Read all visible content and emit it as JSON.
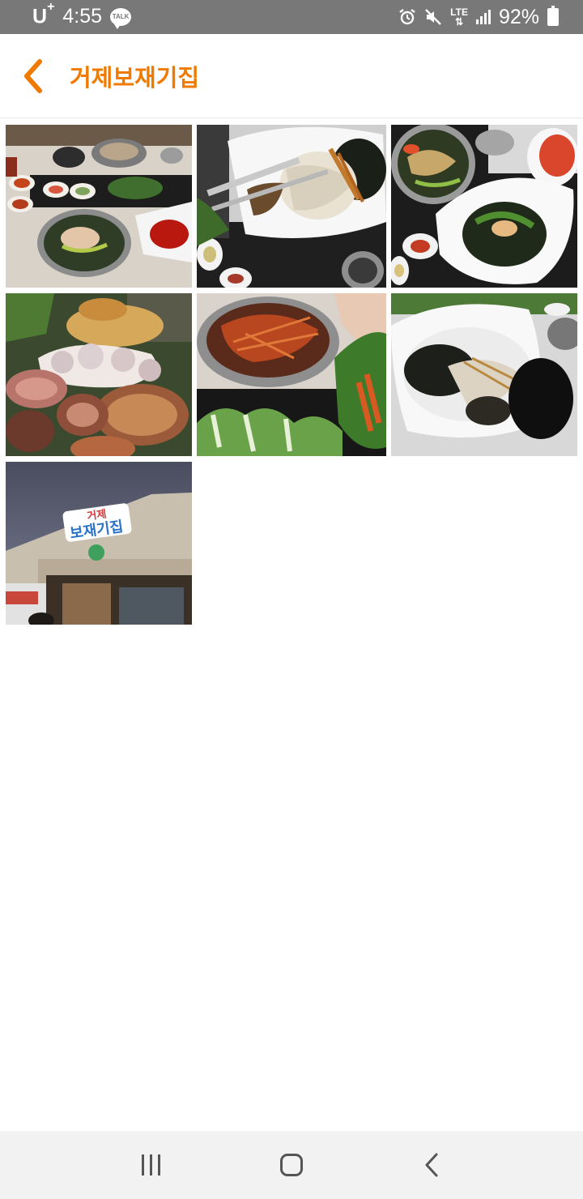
{
  "status_bar": {
    "carrier": "U",
    "carrier_suffix": "+",
    "time": "4:55",
    "talk_badge": "TALK",
    "icons": [
      "alarm-icon",
      "mute-icon",
      "lte-icon",
      "signal-icon"
    ],
    "lte_label": "LTE",
    "battery_percent": "92%"
  },
  "app_bar": {
    "back_icon": "chevron-left-icon",
    "title": "거제보재기집",
    "accent_color": "#f07a00"
  },
  "photos": [
    {
      "subject": "table set with bibimbap bowl and side dishes"
    },
    {
      "subject": "white plate of seafood noodles with seaweed"
    },
    {
      "subject": "bowls of bibimbap and red sauce"
    },
    {
      "subject": "platter of octopus and shellfish"
    },
    {
      "subject": "spicy noodle bowl with lettuce wraps"
    },
    {
      "subject": "white bowl of seaweed and noodles"
    },
    {
      "subject": "restaurant storefront sign",
      "sign_text": "거제 보재기집"
    }
  ],
  "nav_bar": {
    "buttons": [
      "recents-icon",
      "home-icon",
      "back-icon"
    ]
  }
}
